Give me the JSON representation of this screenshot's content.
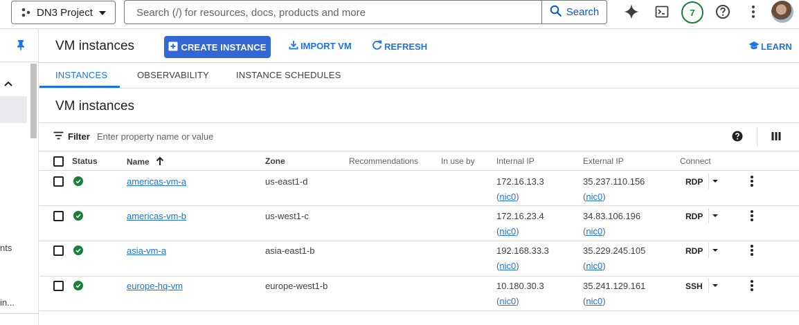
{
  "topbar": {
    "project_name": "DN3 Project",
    "search_placeholder": "Search (/) for resources, docs, products and more",
    "search_button": "Search",
    "notification_count": "7"
  },
  "rail": {
    "truncated_1": "nts",
    "truncated_2": "in..."
  },
  "header": {
    "title": "VM instances",
    "create_label": "CREATE INSTANCE",
    "import_label": "IMPORT VM",
    "refresh_label": "REFRESH",
    "learn_label": "LEARN"
  },
  "tabs": [
    {
      "label": "INSTANCES",
      "active": true
    },
    {
      "label": "OBSERVABILITY",
      "active": false
    },
    {
      "label": "INSTANCE SCHEDULES",
      "active": false
    }
  ],
  "section": {
    "title": "VM instances",
    "filter_label": "Filter",
    "filter_placeholder": "Enter property name or value"
  },
  "table": {
    "columns": {
      "status": "Status",
      "name": "Name",
      "zone": "Zone",
      "recommendations": "Recommendations",
      "in_use_by": "In use by",
      "internal_ip": "Internal IP",
      "external_ip": "External IP",
      "connect": "Connect"
    },
    "rows": [
      {
        "name": "americas-vm-a",
        "zone": "us-east1-d",
        "internal_ip": "172.16.13.3",
        "external_ip": "35.237.110.156",
        "nic": "nic0",
        "connect": "RDP"
      },
      {
        "name": "americas-vm-b",
        "zone": "us-west1-c",
        "internal_ip": "172.16.23.4",
        "external_ip": "34.83.106.196",
        "nic": "nic0",
        "connect": "RDP"
      },
      {
        "name": "asia-vm-a",
        "zone": "asia-east1-b",
        "internal_ip": "192.168.33.3",
        "external_ip": "35.229.245.105",
        "nic": "nic0",
        "connect": "RDP"
      },
      {
        "name": "europe-hq-vm",
        "zone": "europe-west1-b",
        "internal_ip": "10.180.30.3",
        "external_ip": "35.241.129.161",
        "nic": "nic0",
        "connect": "SSH"
      }
    ]
  },
  "colors": {
    "primary": "#1a73e8",
    "create_button": "#3367d6",
    "status_ok": "#188038"
  }
}
